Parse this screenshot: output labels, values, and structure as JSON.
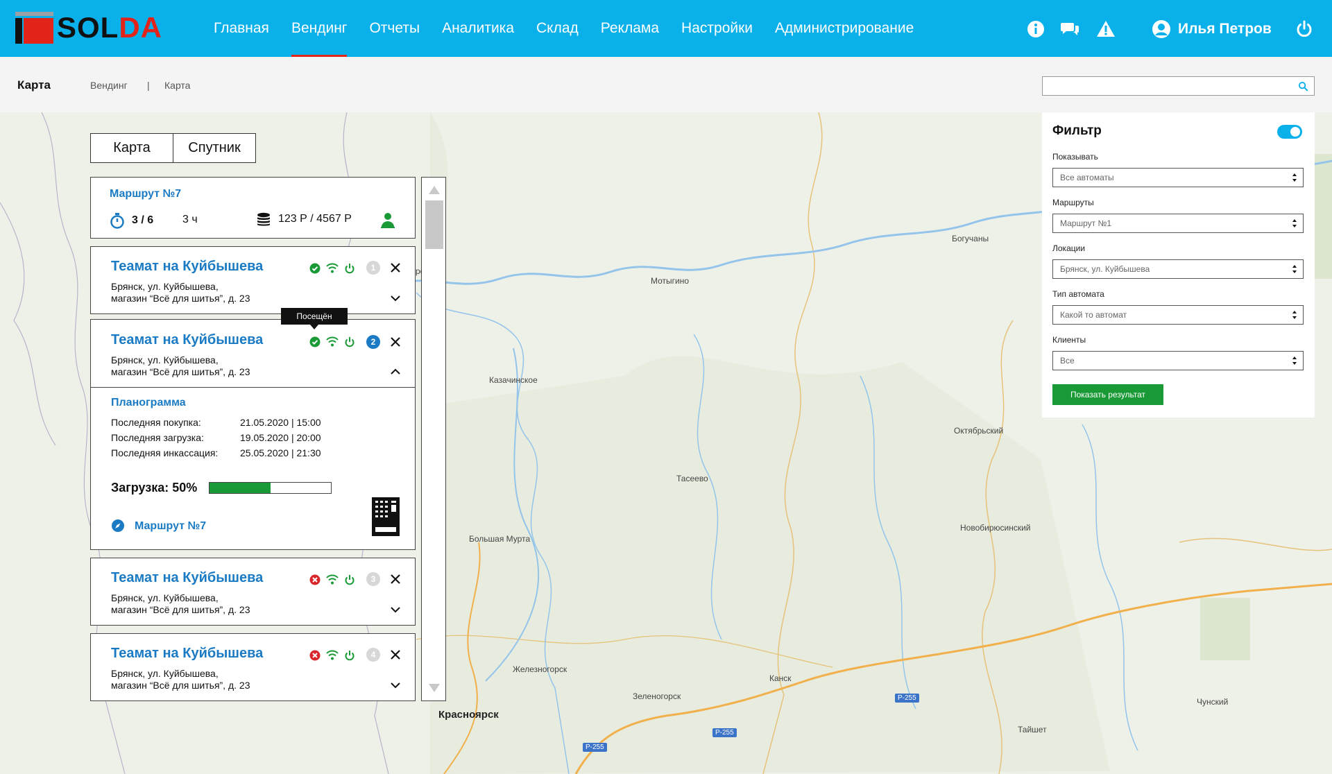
{
  "header": {
    "logo_part1": "SOL",
    "logo_part2": "DA",
    "nav": [
      "Главная",
      "Вендинг",
      "Отчеты",
      "Аналитика",
      "Склад",
      "Реклама",
      "Настройки",
      "Администрирование"
    ],
    "active_nav": "Вендинг",
    "user_name": "Илья Петров",
    "icons": [
      "info-icon",
      "chat-icon",
      "warning-icon",
      "user-icon",
      "power-icon"
    ]
  },
  "subheader": {
    "page_title": "Карта",
    "breadcrumb": [
      "Вендинг",
      "|",
      "Карта"
    ],
    "search_placeholder": ""
  },
  "map": {
    "type_buttons": [
      "Карта",
      "Спутник"
    ],
    "labels": [
      {
        "text": "Мотыгино"
      },
      {
        "text": "Богучаны"
      },
      {
        "text": "Казачинское"
      },
      {
        "text": "Октябрьский"
      },
      {
        "text": "Тасеево"
      },
      {
        "text": "Большая Мурта"
      },
      {
        "text": "Новобирюсинский"
      },
      {
        "text": "Железногорск"
      },
      {
        "text": "Канск"
      },
      {
        "text": "Зеленогорск"
      },
      {
        "text": "Красноярск"
      },
      {
        "text": "Тайшет"
      },
      {
        "text": "Чунский"
      },
      {
        "text": "рск"
      }
    ],
    "roads": [
      "P-255",
      "P-255",
      "P-255"
    ]
  },
  "route": {
    "title": "Маршрут №7",
    "progress": "3 / 6",
    "time": "3 ч",
    "money": "123 Р / 4567 Р"
  },
  "machines": [
    {
      "title": "Теамат на Куйбышева",
      "addr1": "Брянск, ул. Куйбышева,",
      "addr2": "магазин “Всё для шитья”, д. 23",
      "num": "1",
      "status": "ok"
    },
    {
      "title": "Теамат на Куйбышева",
      "addr1": "Брянск, ул. Куйбышева,",
      "addr2": "магазин “Всё для шитья”, д. 23",
      "num": "2",
      "status": "ok"
    },
    {
      "title": "Теамат на Куйбышева",
      "addr1": "Брянск, ул. Куйбышева,",
      "addr2": "магазин “Всё для шитья”, д. 23",
      "num": "3",
      "status": "error"
    },
    {
      "title": "Теамат на Куйбышева",
      "addr1": "Брянск, ул. Куйбышева,",
      "addr2": "магазин “Всё для шитья”, д. 23",
      "num": "4",
      "status": "error"
    }
  ],
  "tooltip": "Посещён",
  "details": {
    "planogram": "Планограмма",
    "rows": [
      {
        "label": "Последняя покупка:",
        "value": "21.05.2020 | 15:00"
      },
      {
        "label": "Последняя загрузка:",
        "value": "19.05.2020 | 20:00"
      },
      {
        "label": "Последняя инкассация:",
        "value": "25.05.2020 | 21:30"
      }
    ],
    "load_label": "Загрузка: 50%",
    "load_value": 0.5,
    "route_link": "Маршрут №7"
  },
  "filter": {
    "title": "Фильтр",
    "enabled": true,
    "fields": [
      {
        "label": "Показывать",
        "value": "Все автоматы"
      },
      {
        "label": "Маршруты",
        "value": "Маршрут №1"
      },
      {
        "label": "Локации",
        "value": "Брянск, ул. Куйбышева"
      },
      {
        "label": "Тип автомата",
        "value": "Какой то автомат"
      },
      {
        "label": "Клиенты",
        "value": "Все"
      }
    ],
    "submit": "Показать результат"
  },
  "colors": {
    "header": "#0ab0ea",
    "accent": "#e2231a",
    "link": "#1a7bc4",
    "ok": "#1a9a36",
    "error": "#d9262c"
  }
}
